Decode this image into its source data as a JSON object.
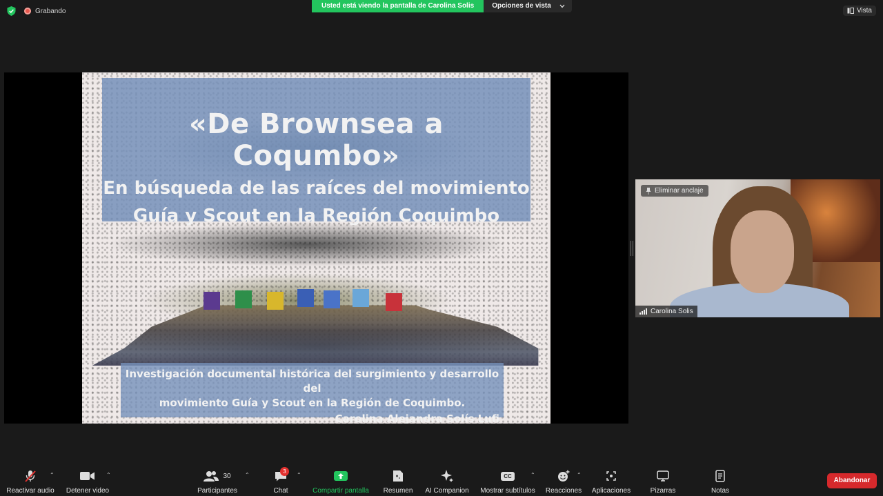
{
  "top": {
    "recording_label": "Grabando",
    "share_banner": "Usted está viendo la pantalla de Carolina Solis",
    "view_options": "Opciones de vista",
    "view_button": "Vista"
  },
  "slide": {
    "title": "«De Brownsea a Coqumbo»",
    "subtitle_line1": "En búsqueda de las raíces del movimiento",
    "subtitle_line2": "Guía y Scout en la Región Coquimbo",
    "desc_line1": "Investigación documental histórica del surgimiento y desarrollo del",
    "desc_line2": "movimiento Guía y Scout en la Región de Coquimbo.",
    "author": "Carolina Alejandra Solís Lufi"
  },
  "video": {
    "unpin_label": "Eliminar anclaje",
    "participant_name": "Carolina Solis"
  },
  "toolbar": {
    "audio": "Reactivar audio",
    "video": "Detener video",
    "participants": "Participantes",
    "participants_count": "30",
    "chat": "Chat",
    "chat_badge": "3",
    "share": "Compartir pantalla",
    "summary": "Resumen",
    "companion": "AI Companion",
    "captions": "Mostrar subtítulos",
    "captions_icon_text": "CC",
    "reactions": "Reacciones",
    "apps": "Aplicaciones",
    "whiteboards": "Pizarras",
    "notes": "Notas",
    "leave": "Abandonar"
  },
  "colors": {
    "share_green": "#23c55e",
    "leave_red": "#d6292c",
    "slide_box_blue": "#7691ba"
  }
}
